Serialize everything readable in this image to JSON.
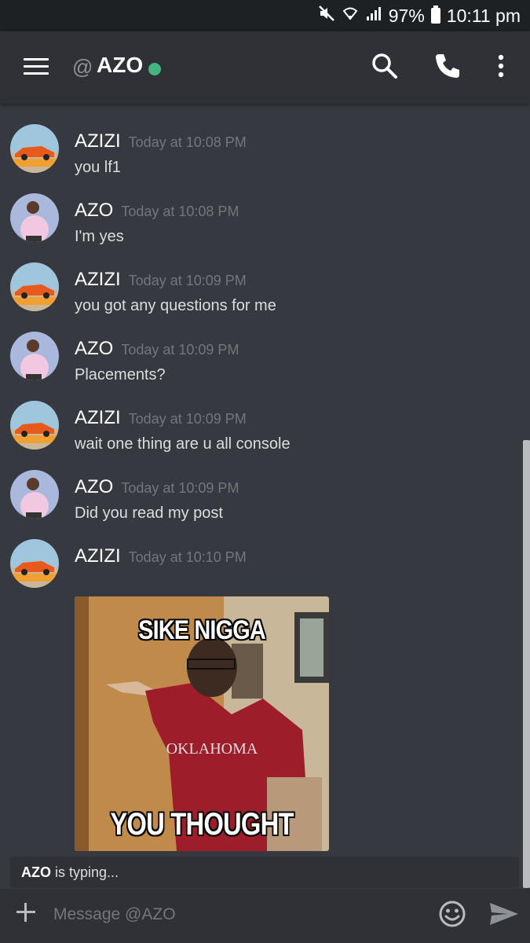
{
  "statusbar": {
    "battery_percent": "97%",
    "time": "10:11 pm",
    "icons": [
      "mute-icon",
      "wifi-icon",
      "signal-icon",
      "battery-icon"
    ]
  },
  "header": {
    "at_symbol": "@",
    "channel_name": "AZO",
    "online_status_color": "#43b581",
    "actions": [
      "search-icon",
      "call-icon",
      "more-icon"
    ]
  },
  "messages": [
    {
      "author": "AZIZI",
      "timestamp": "Today at 10:08 PM",
      "content": "you lf1",
      "avatar": "car-avatar"
    },
    {
      "author": "AZO",
      "timestamp": "Today at 10:08 PM",
      "content": "I'm yes",
      "avatar": "person-avatar"
    },
    {
      "author": "AZIZI",
      "timestamp": "Today at 10:09 PM",
      "content": "you got any questions for me",
      "avatar": "car-avatar"
    },
    {
      "author": "AZO",
      "timestamp": "Today at 10:09 PM",
      "content": "Placements?",
      "avatar": "person-avatar"
    },
    {
      "author": "AZIZI",
      "timestamp": "Today at 10:09 PM",
      "content": "wait one thing are u all console",
      "avatar": "car-avatar"
    },
    {
      "author": "AZO",
      "timestamp": "Today at 10:09 PM",
      "content": "Did you read my post",
      "avatar": "person-avatar"
    },
    {
      "author": "AZIZI",
      "timestamp": "Today at 10:10 PM",
      "content": "",
      "avatar": "car-avatar"
    }
  ],
  "meme": {
    "top_text": "SIKE NIGGA",
    "bottom_text": "YOU THOUGHT",
    "shirt_text": "OKLAHOMA"
  },
  "typing": {
    "user": "AZO",
    "suffix": " is typing..."
  },
  "composer": {
    "placeholder": "Message @AZO",
    "icons": [
      "plus-icon",
      "emoji-icon",
      "send-icon"
    ]
  },
  "colors": {
    "background": "#36393f",
    "panel": "#2f3136",
    "status_bar": "#1e2124",
    "online": "#43b581",
    "timestamp": "#72767d"
  }
}
